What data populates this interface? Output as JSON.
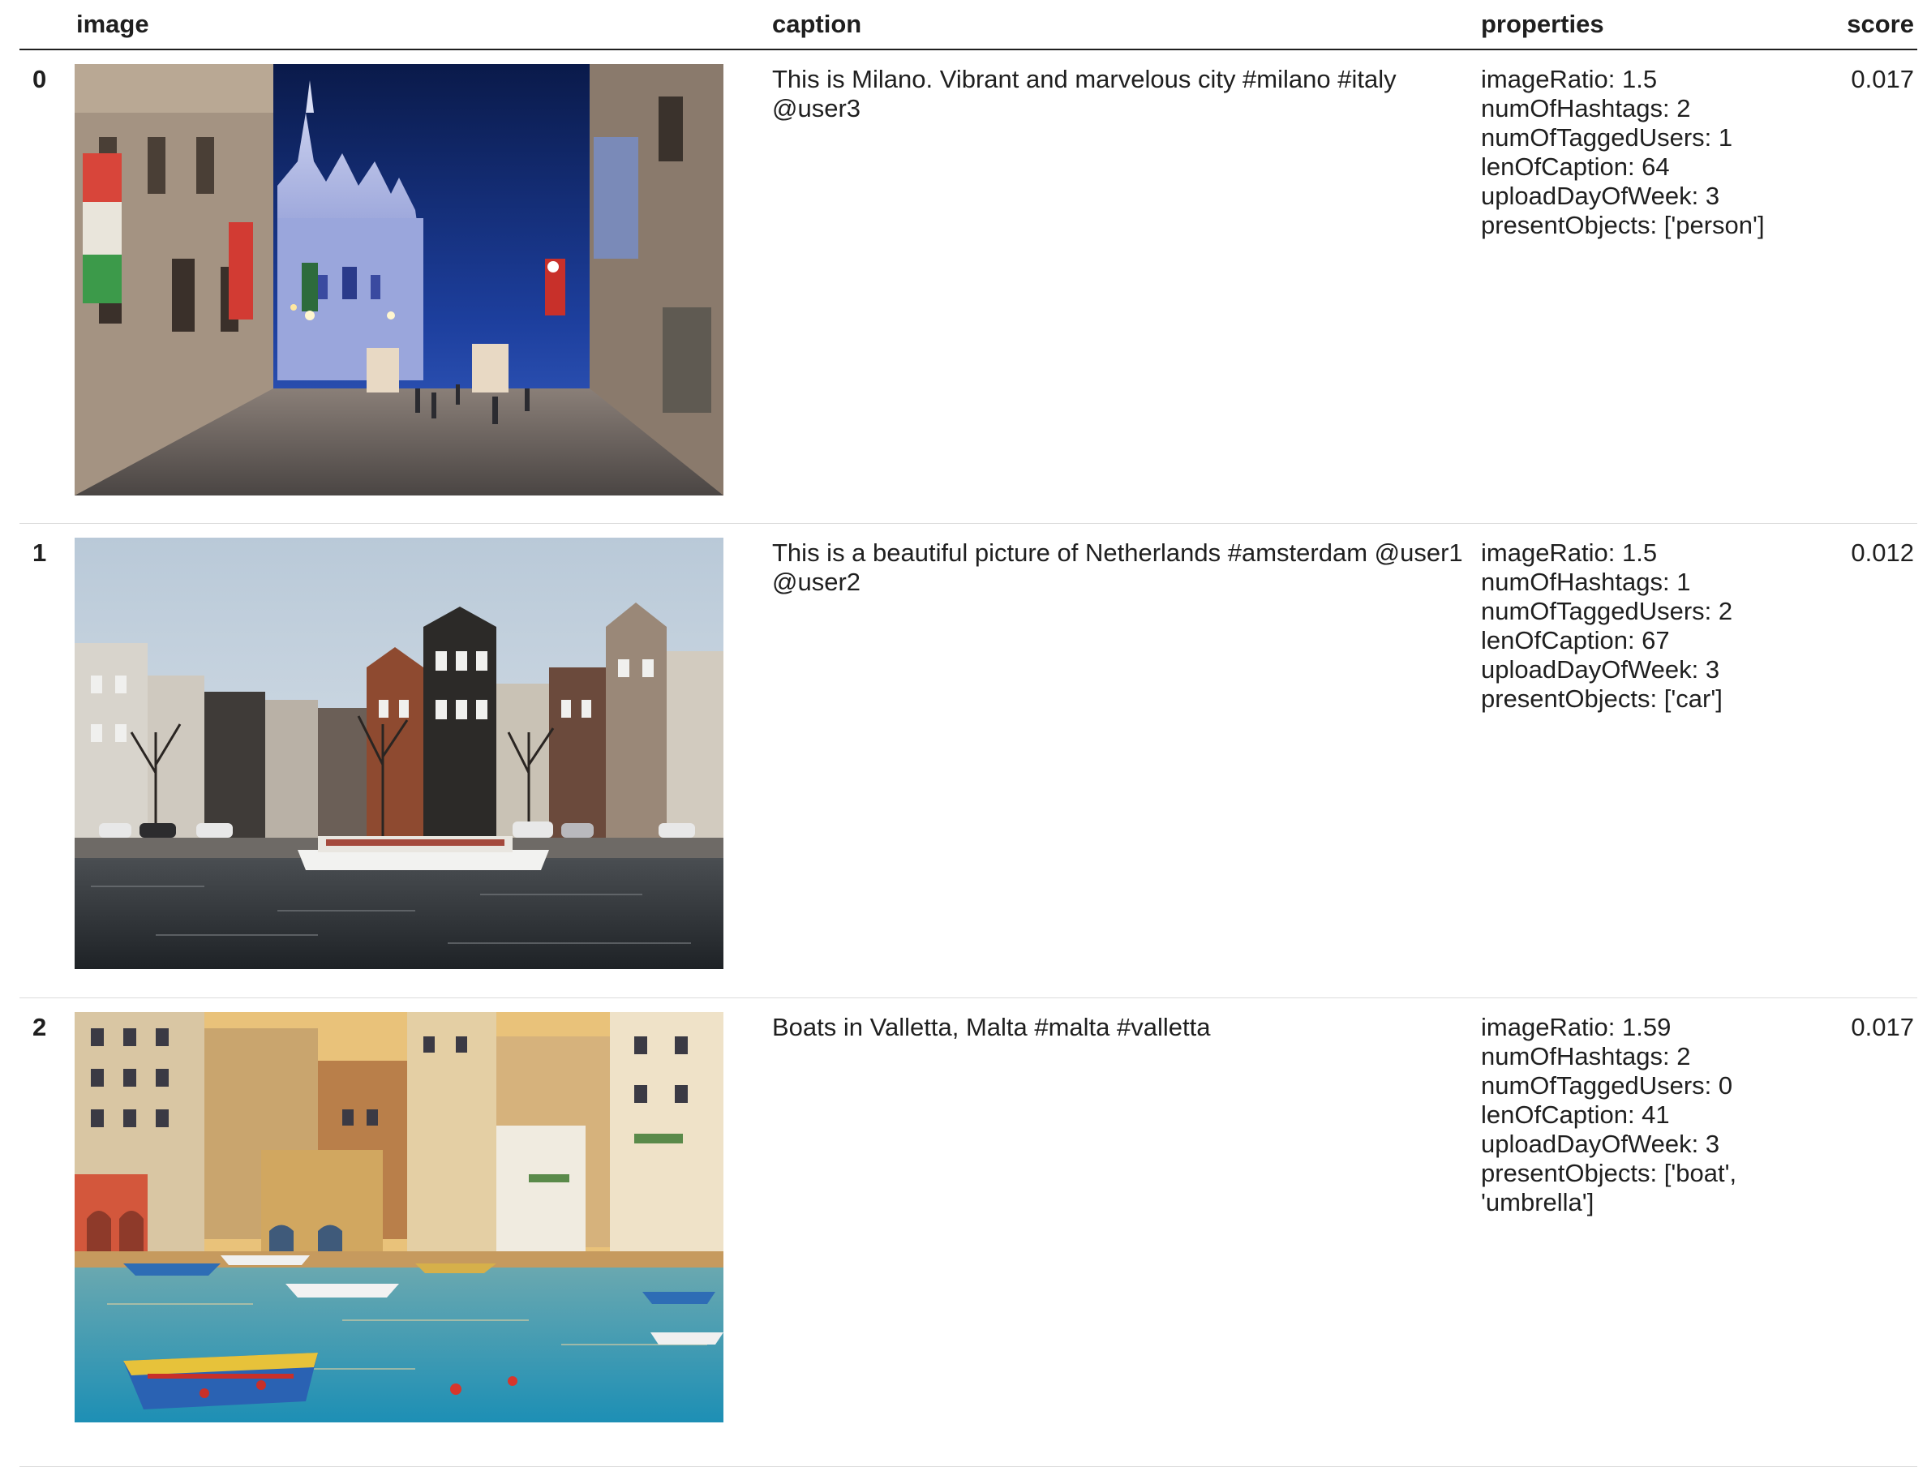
{
  "columns": {
    "image": "image",
    "caption": "caption",
    "properties": "properties",
    "score": "score"
  },
  "rows": [
    {
      "index": "0",
      "image_subject": "Milan cathedral square at dusk",
      "caption": "This is Milano. Vibrant and marvelous city #milano #italy @user3",
      "properties": [
        "imageRatio: 1.5",
        "numOfHashtags: 2",
        "numOfTaggedUsers: 1",
        "lenOfCaption: 64",
        "uploadDayOfWeek: 3",
        "presentObjects: ['person']"
      ],
      "score": "0.017"
    },
    {
      "index": "1",
      "image_subject": "Amsterdam canal houses with a boat",
      "caption": "This is a beautiful picture of Netherlands #amsterdam @user1 @user2",
      "properties": [
        "imageRatio: 1.5",
        "numOfHashtags: 1",
        "numOfTaggedUsers: 2",
        "lenOfCaption: 67",
        "uploadDayOfWeek: 3",
        "presentObjects: ['car']"
      ],
      "score": "0.012"
    },
    {
      "index": "2",
      "image_subject": "Colorful boats in Valletta harbour",
      "caption": "Boats in Valletta, Malta #malta #valletta",
      "properties": [
        "imageRatio: 1.59",
        "numOfHashtags: 2",
        "numOfTaggedUsers: 0",
        "lenOfCaption: 41",
        "uploadDayOfWeek: 3",
        "presentObjects: ['boat',",
        "'umbrella']"
      ],
      "score": "0.017"
    }
  ]
}
